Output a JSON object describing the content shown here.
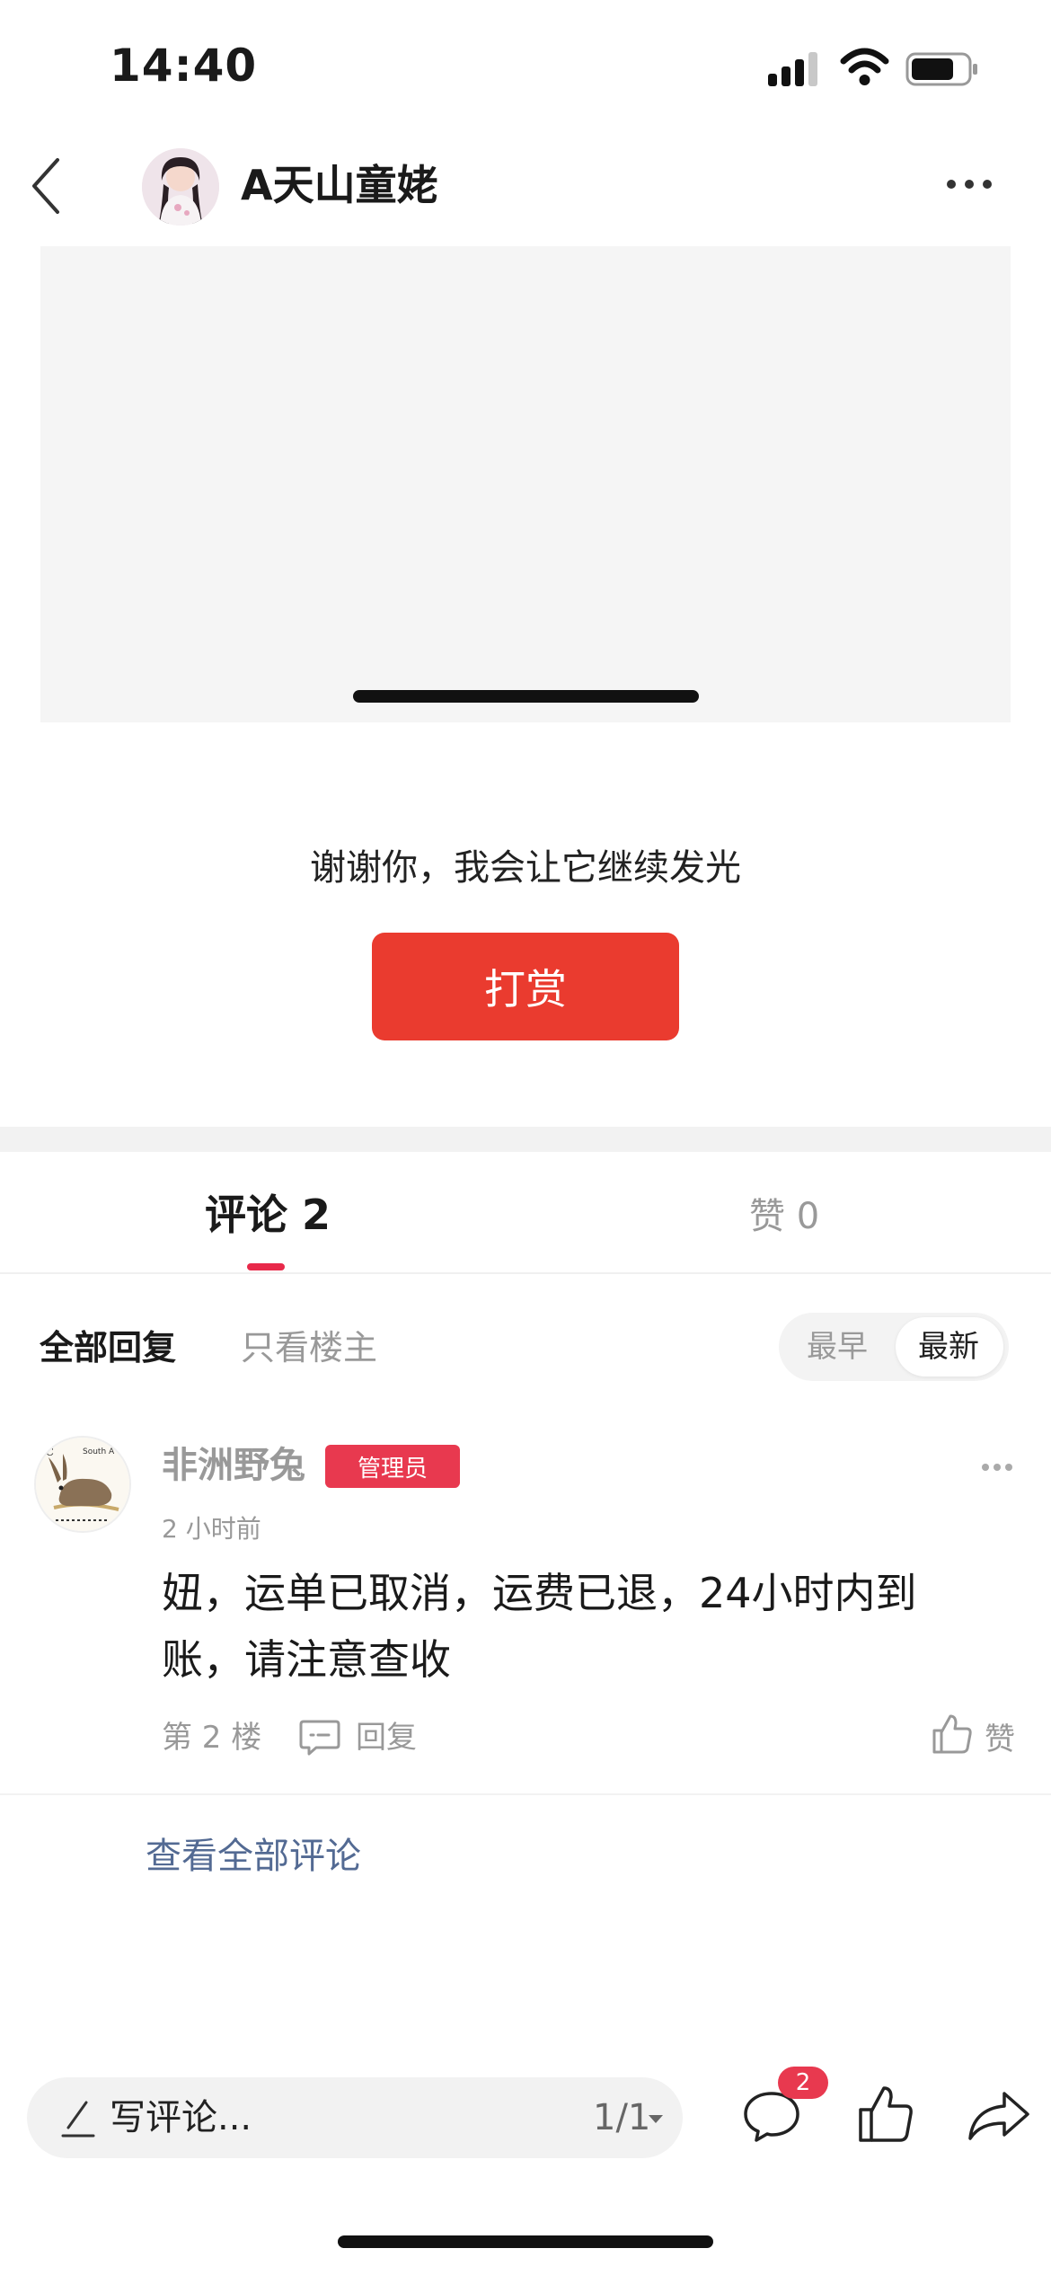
{
  "status_bar": {
    "time": "14:40"
  },
  "nav": {
    "title": "A天山童姥"
  },
  "reward": {
    "thanks_text": "谢谢你，我会让它继续发光",
    "button_label": "打赏"
  },
  "tabs": {
    "comments_label": "评论 2",
    "likes_label": "赞 0"
  },
  "filters": {
    "all_label": "全部回复",
    "host_only_label": "只看楼主",
    "sort_earliest": "最早",
    "sort_newest": "最新",
    "sort_selected": "最新"
  },
  "comment": {
    "author": "非洲野兔",
    "badge": "管理员",
    "time": "2 小时前",
    "text": "妞，运单已取消，运费已退，24小时内到账，请注意查收",
    "floor": "第 2 楼",
    "reply_label": "回复",
    "like_label": "赞"
  },
  "view_all_label": "查看全部评论",
  "bottom_bar": {
    "input_placeholder": "写评论...",
    "page_indicator": "1/1",
    "comment_badge_count": "2"
  },
  "colors": {
    "accent_red": "#ea3b2f",
    "badge_red": "#e8394f",
    "tab_indicator": "#e8294a",
    "link_blue": "#536a93"
  }
}
